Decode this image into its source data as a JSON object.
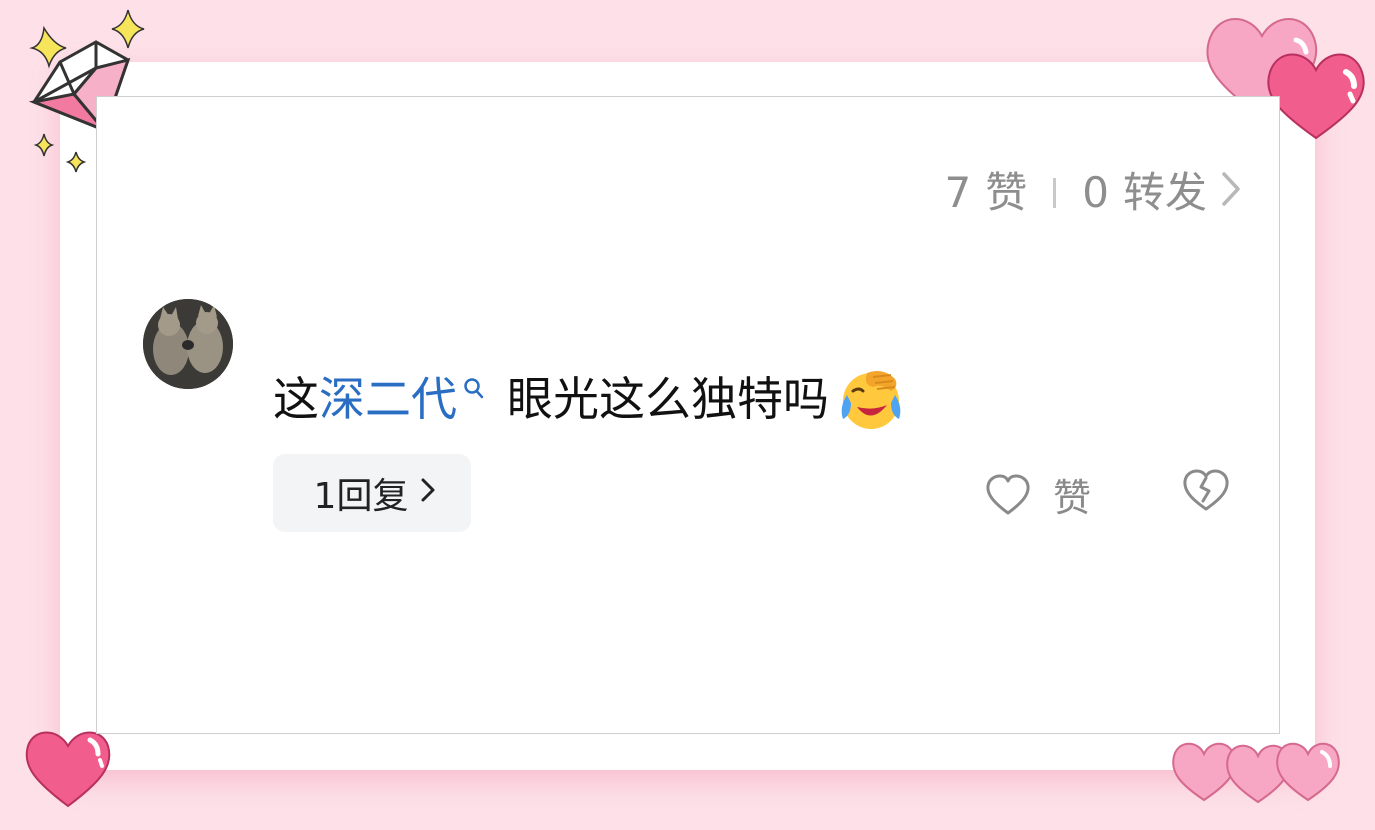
{
  "post_stats": {
    "likes_count": "7",
    "likes_label": "赞",
    "reposts_count": "0",
    "reposts_label": "转发",
    "chevron": "›"
  },
  "comment": {
    "avatar_icon": "cats-avatar",
    "text_before": "这",
    "topic_link": "深二代",
    "topic_icon": "search-icon",
    "text_after": "眼光这么独特吗",
    "emoji": "face-holding-back-tears-laughing"
  },
  "actions": {
    "reply_label": "1回复",
    "reply_chevron": "›",
    "like_label": "赞",
    "like_icon": "heart-outline-icon",
    "dislike_icon": "broken-heart-icon"
  },
  "colors": {
    "background": "#fde0e8",
    "link": "#2a6ec3",
    "heart_pink": "#f7a6c3",
    "heart_magenta": "#f15e8e"
  }
}
